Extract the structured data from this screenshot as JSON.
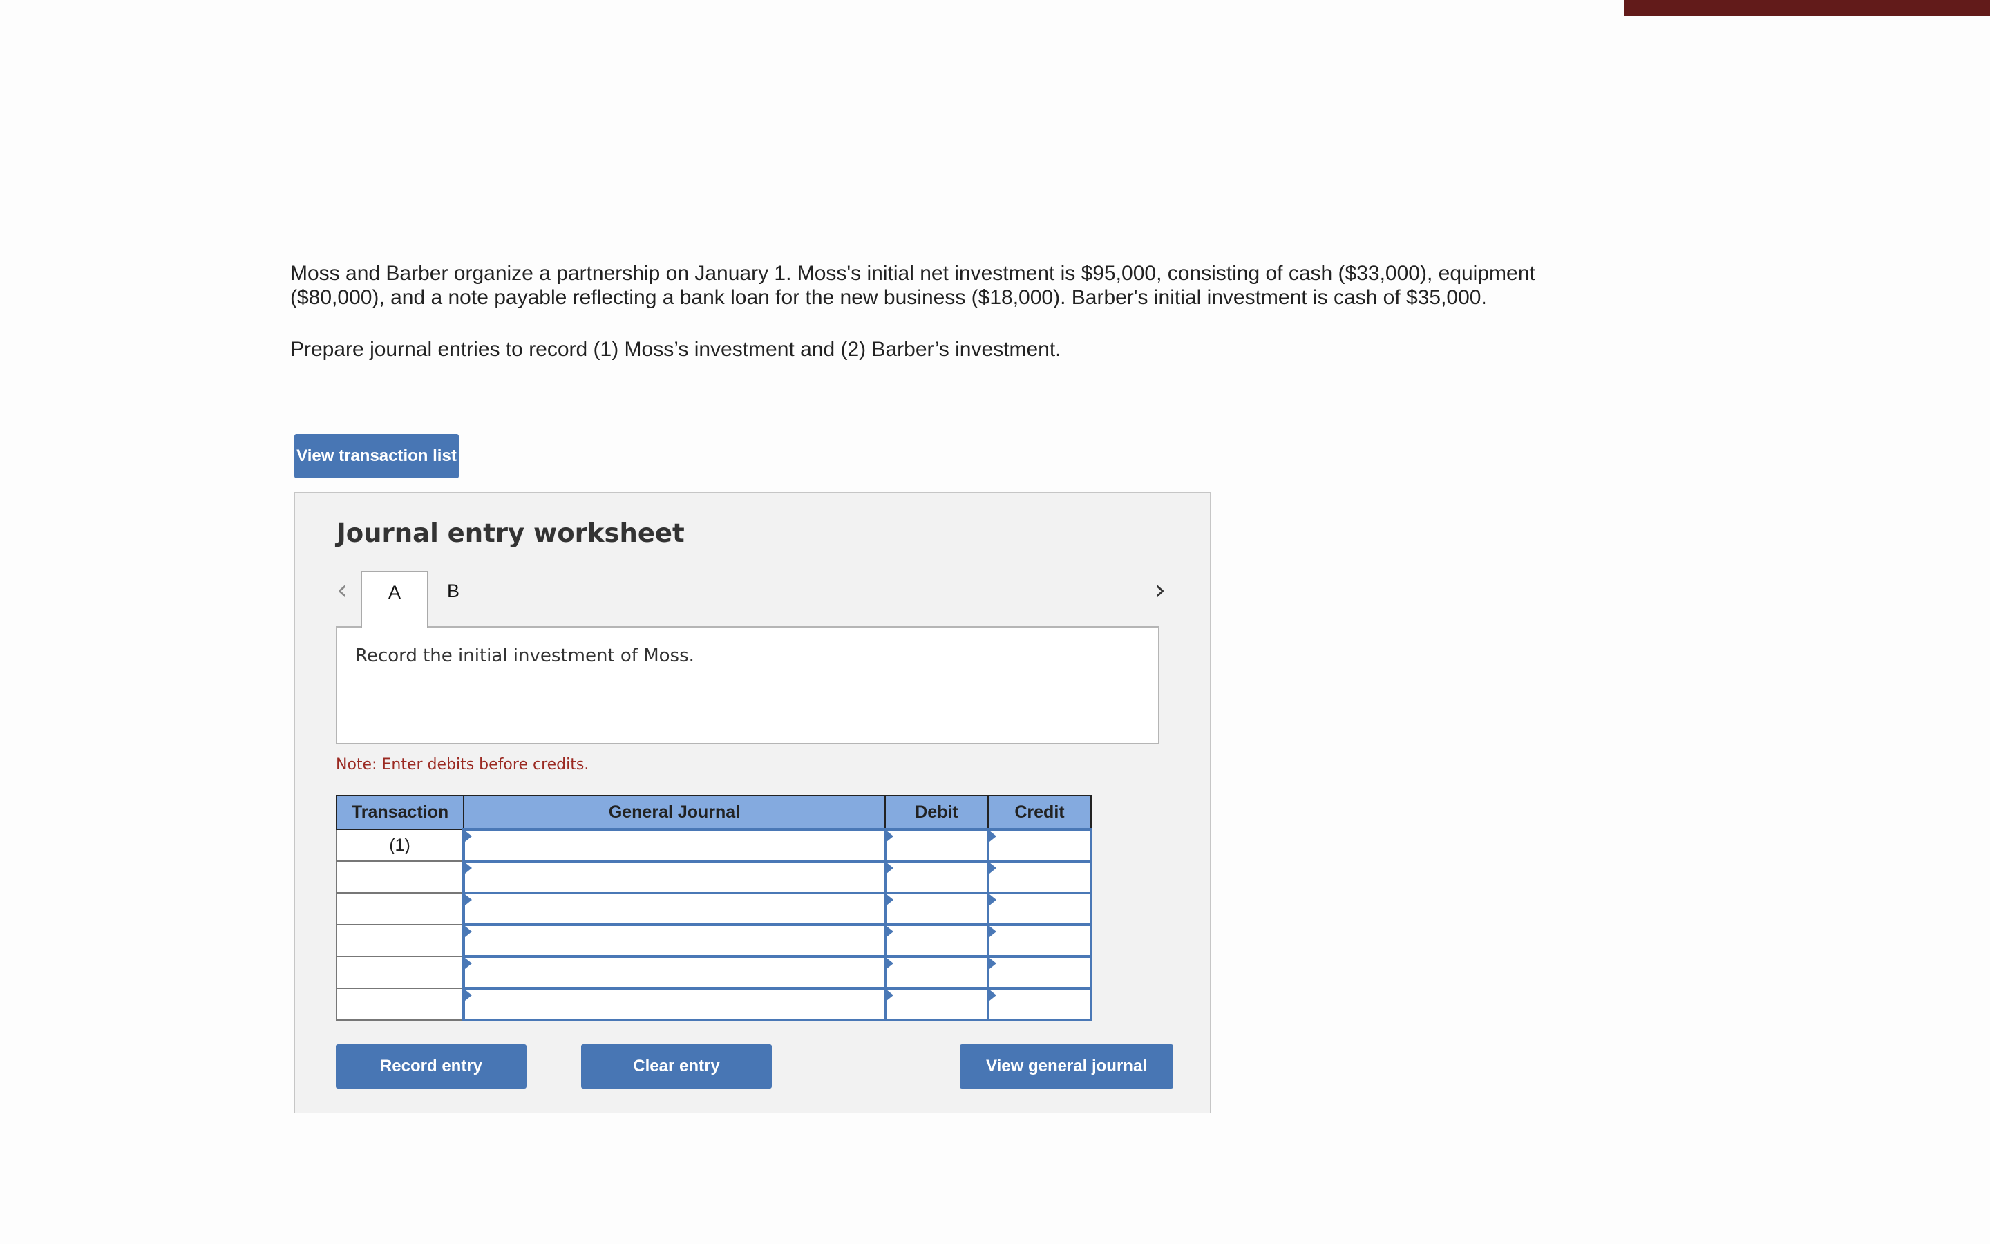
{
  "colors": {
    "top_bar": "#621b1a",
    "button": "#4876b4",
    "table_header": "#84aadf",
    "note": "#9b2a22",
    "input_border": "#4a78b6"
  },
  "problem": {
    "paragraph": "Moss and Barber organize a partnership on January 1. Moss's initial net investment is $95,000, consisting of cash ($33,000), equipment ($80,000), and a note payable reflecting a bank loan for the new business ($18,000). Barber's initial investment is cash of $35,000.",
    "instruction": "Prepare journal entries to record (1) Moss’s investment and (2) Barber’s investment."
  },
  "buttons": {
    "view_transaction_list": "View transaction list",
    "record_entry": "Record entry",
    "clear_entry": "Clear entry",
    "view_general_journal": "View general journal"
  },
  "worksheet": {
    "title": "Journal entry worksheet",
    "prev_icon": "‹",
    "next_icon": "›",
    "tabs": [
      {
        "label": "A",
        "active": true
      },
      {
        "label": "B",
        "active": false
      }
    ],
    "description": "Record the initial investment of Moss.",
    "note": "Note: Enter debits before credits."
  },
  "table": {
    "headers": [
      "Transaction",
      "General Journal",
      "Debit",
      "Credit"
    ],
    "rows": [
      {
        "transaction": "(1)",
        "account": "",
        "debit": "",
        "credit": ""
      },
      {
        "transaction": "",
        "account": "",
        "debit": "",
        "credit": ""
      },
      {
        "transaction": "",
        "account": "",
        "debit": "",
        "credit": ""
      },
      {
        "transaction": "",
        "account": "",
        "debit": "",
        "credit": ""
      },
      {
        "transaction": "",
        "account": "",
        "debit": "",
        "credit": ""
      },
      {
        "transaction": "",
        "account": "",
        "debit": "",
        "credit": ""
      }
    ]
  }
}
